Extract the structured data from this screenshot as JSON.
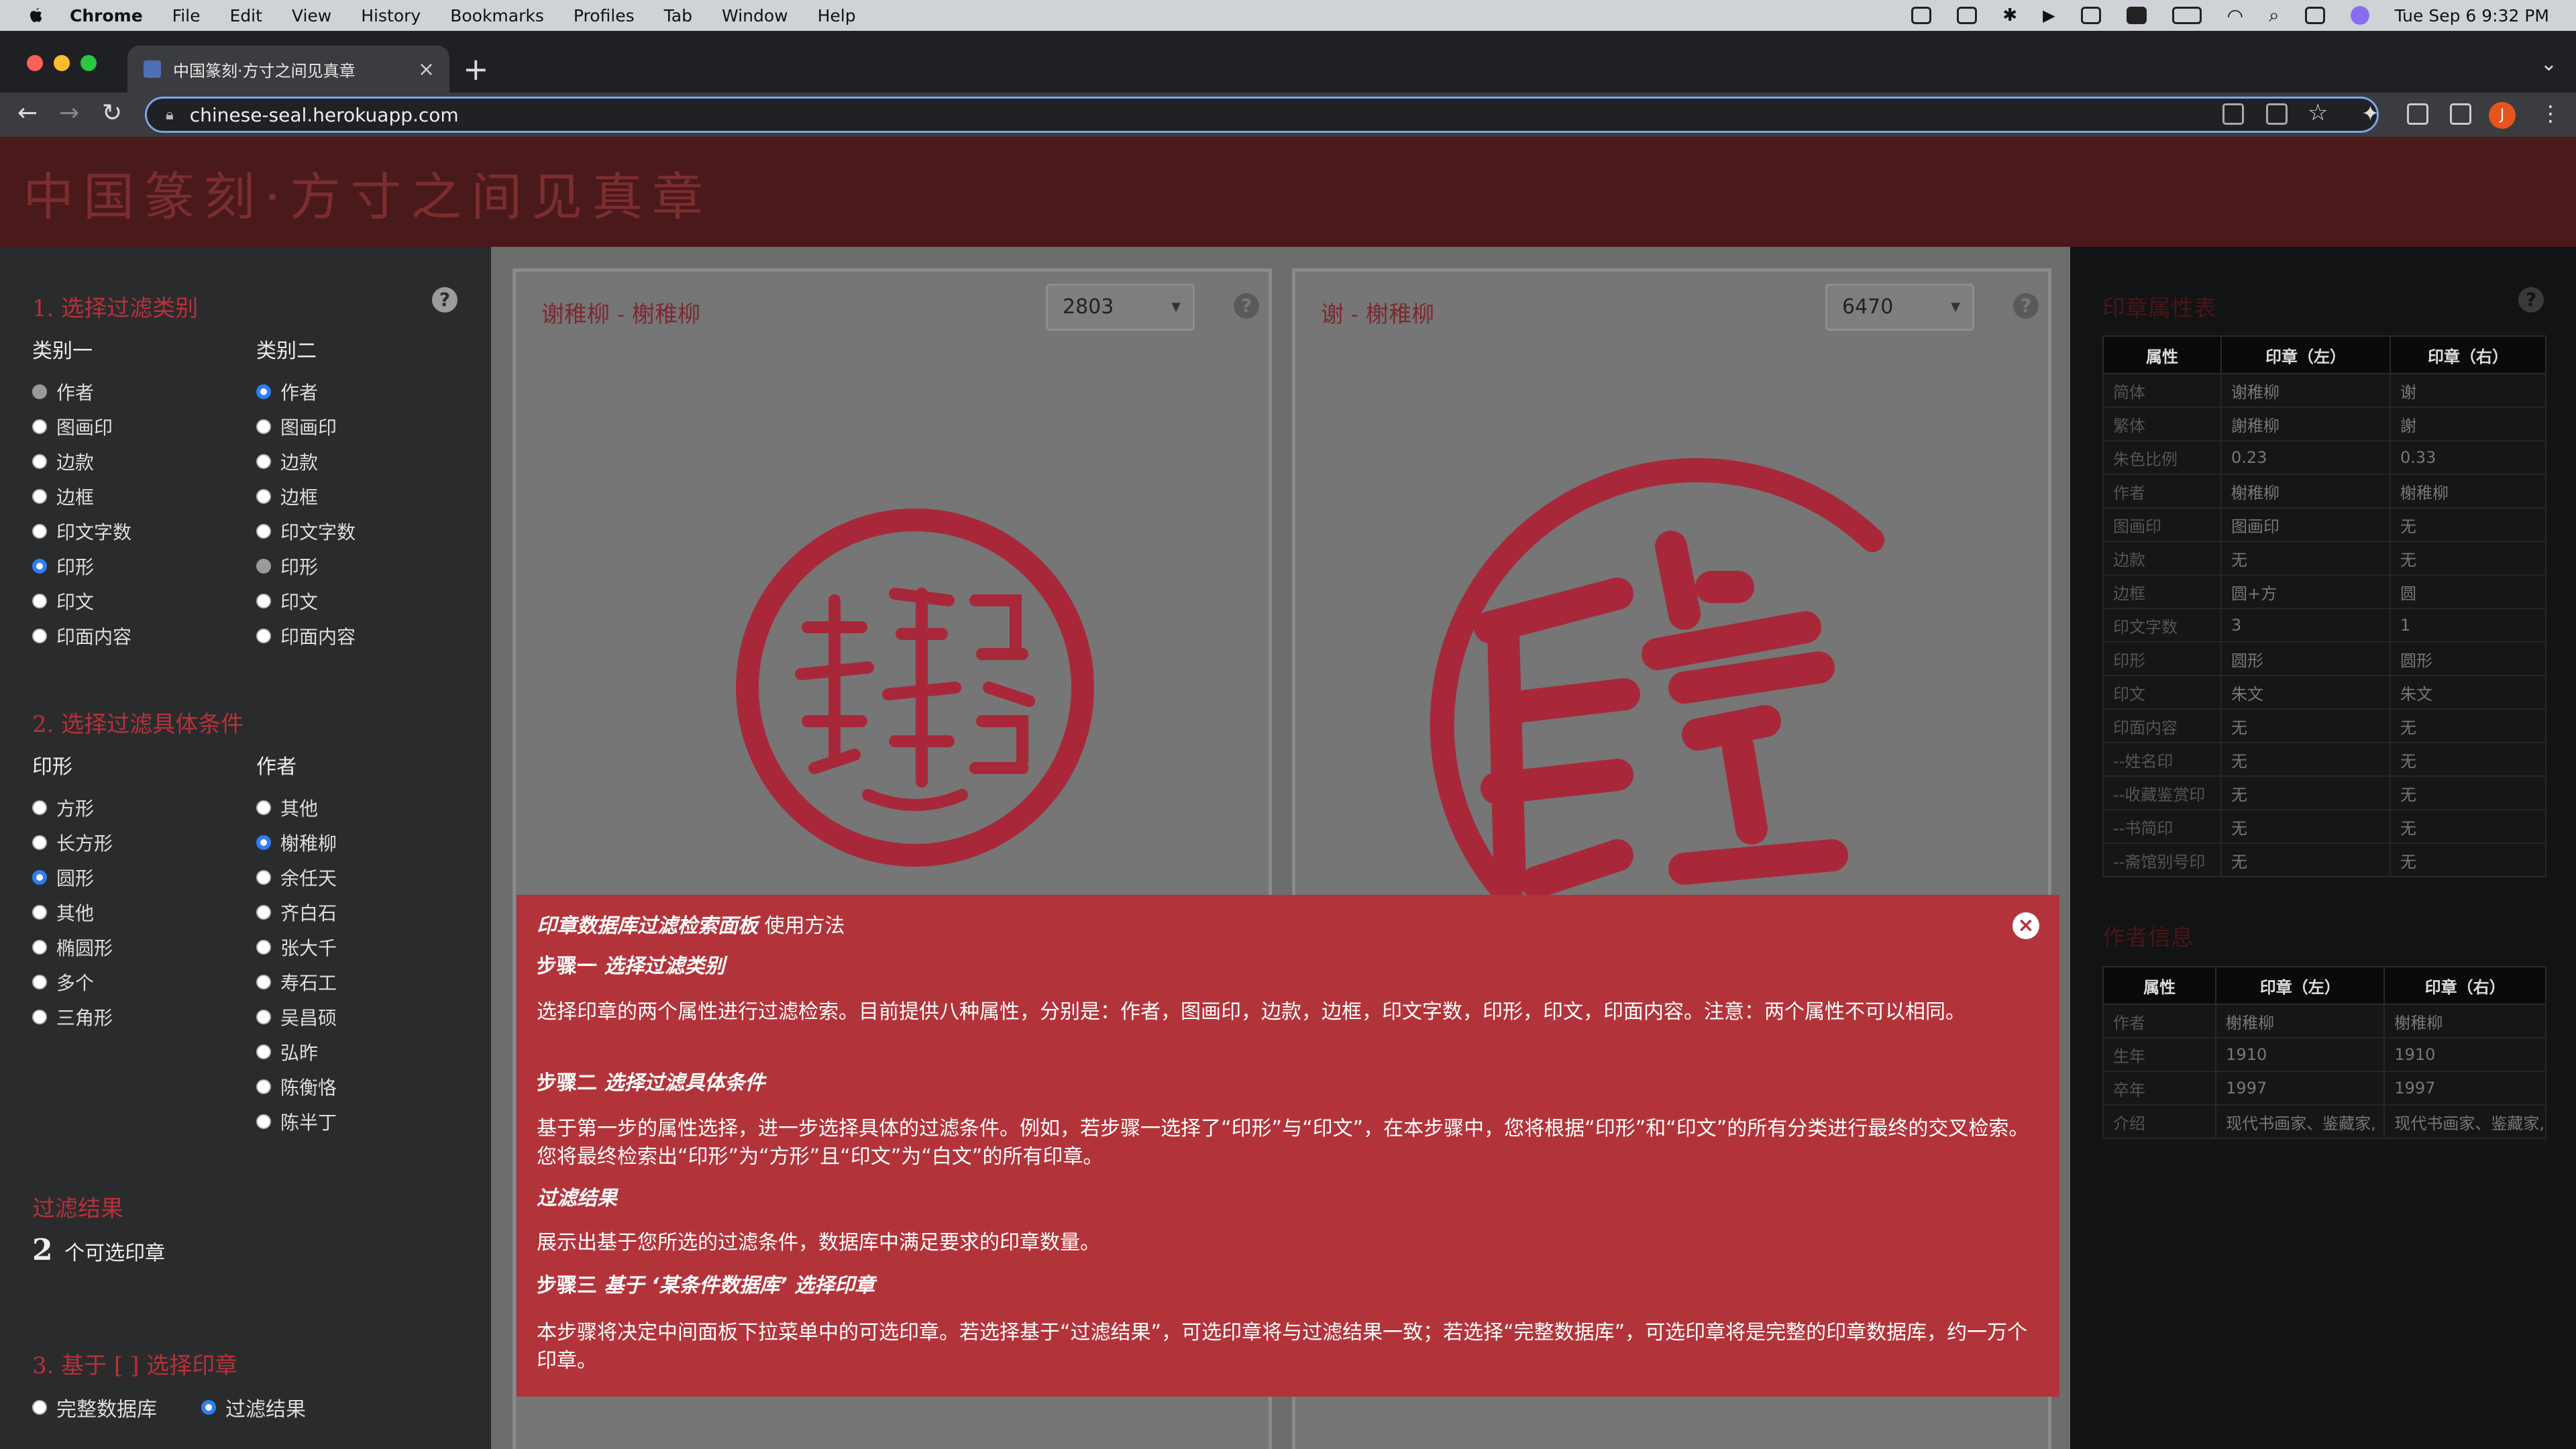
{
  "menubar": {
    "app": "Chrome",
    "items": [
      "File",
      "Edit",
      "View",
      "History",
      "Bookmarks",
      "Profiles",
      "Tab",
      "Window",
      "Help"
    ],
    "clock": "Tue Sep 6  9:32 PM"
  },
  "browser": {
    "tab_title": "中国篆刻·方寸之间见真章",
    "url": "chinese-seal.herokuapp.com",
    "avatar_letter": "J"
  },
  "site": {
    "title": "中国篆刻·方寸之间见真章"
  },
  "left": {
    "step1": {
      "title": "1. 选择过滤类别",
      "col1_title": "类别一",
      "col2_title": "类别二",
      "options": [
        "作者",
        "图画印",
        "边款",
        "边框",
        "印文字数",
        "印形",
        "印文",
        "印面内容"
      ]
    },
    "step2": {
      "title": "2. 选择过滤具体条件",
      "col1_title": "印形",
      "col1_options": [
        "方形",
        "长方形",
        "圆形",
        "其他",
        "椭圆形",
        "多个",
        "三角形"
      ],
      "col2_title": "作者",
      "col2_options": [
        "其他",
        "榭稚柳",
        "余任天",
        "齐白石",
        "张大千",
        "寿石工",
        "吴昌硕",
        "弘昨",
        "陈衡恪",
        "陈半丁"
      ]
    },
    "result": {
      "title": "过滤结果",
      "count": "2",
      "suffix": "个可选印章"
    },
    "step3": {
      "title": "3. 基于 [ ] 选择印章",
      "opt1": "完整数据库",
      "opt2": "过滤结果"
    }
  },
  "panels": {
    "left": {
      "title": "谢稚柳 - 榭稚柳",
      "select": "2803"
    },
    "right": {
      "title": "谢 - 榭稚柳",
      "select": "6470"
    }
  },
  "right": {
    "attr_title": "印章属性表",
    "attr_headers": [
      "属性",
      "印章（左）",
      "印章（右）"
    ],
    "attr_rows": [
      [
        "简体",
        "谢稚柳",
        "谢"
      ],
      [
        "繁体",
        "謝稚柳",
        "謝"
      ],
      [
        "朱色比例",
        "0.23",
        "0.33"
      ],
      [
        "作者",
        "榭稚柳",
        "榭稚柳"
      ],
      [
        "图画印",
        "图画印",
        "无"
      ],
      [
        "边款",
        "无",
        "无"
      ],
      [
        "边框",
        "圆+方",
        "圆"
      ],
      [
        "印文字数",
        "3",
        "1"
      ],
      [
        "印形",
        "圆形",
        "圆形"
      ],
      [
        "印文",
        "朱文",
        "朱文"
      ],
      [
        "印面内容",
        "无",
        "无"
      ],
      [
        "--姓名印",
        "无",
        "无"
      ],
      [
        "--收藏鉴赏印",
        "无",
        "无"
      ],
      [
        "--书简印",
        "无",
        "无"
      ],
      [
        "--斋馆别号印",
        "无",
        "无"
      ]
    ],
    "author_title": "作者信息",
    "author_headers": [
      "属性",
      "印章（左）",
      "印章（右）"
    ],
    "author_rows": [
      [
        "作者",
        "榭稚柳",
        "榭稚柳"
      ],
      [
        "生年",
        "1910",
        "1910"
      ],
      [
        "卒年",
        "1997",
        "1997"
      ],
      [
        "介绍",
        "现代书画家、鉴藏家,",
        "现代书画家、鉴藏家,"
      ]
    ]
  },
  "modal": {
    "heading_bold": "印章数据库过滤检索面板",
    "heading_rest": " 使用方法",
    "s1_prefix": "步骤一 ",
    "s1_title": "选择过滤类别",
    "s1_text": "选择印章的两个属性进行过滤检索。目前提供八种属性，分别是：作者，图画印，边款，边框，印文字数，印形，印文，印面内容。注意：两个属性不可以相同。",
    "s2_prefix": "步骤二 ",
    "s2_title": "选择过滤具体条件",
    "s2_text": "基于第一步的属性选择，进一步选择具体的过滤条件。例如，若步骤一选择了“印形”与“印文”，在本步骤中，您将根据“印形”和“印文”的所有分类进行最终的交叉检索。您将最终检索出“印形”为“方形”且“印文”为“白文”的所有印章。",
    "r_title": "过滤结果",
    "r_text": "展示出基于您所选的过滤条件，数据库中满足要求的印章数量。",
    "s3_prefix": "步骤三 ",
    "s3_title": "基于 ‘某条件数据库’ 选择印章",
    "s3_text": "本步骤将决定中间面板下拉菜单中的可选印章。若选择基于“过滤结果”，可选印章将与过滤结果一致；若选择“完整数据库”，可选印章将是完整的印章数据库，约一万个印章。"
  },
  "colors": {
    "accent": "#b8313a",
    "header_bg": "#4a191b",
    "modal_bg": "#b2343a",
    "seal_red": "#b0283a"
  }
}
